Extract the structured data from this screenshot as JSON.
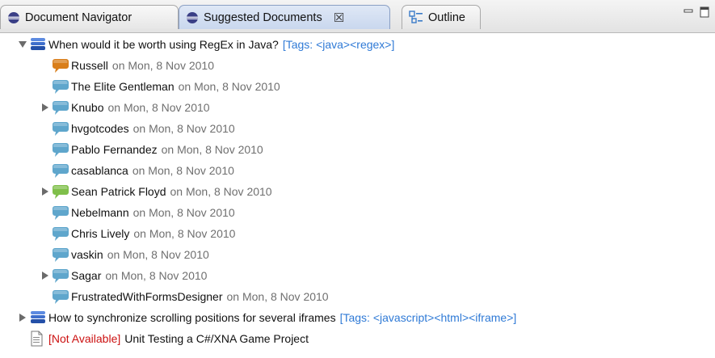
{
  "tabs": [
    {
      "label": "Document Navigator",
      "icon": "eclipse-icon",
      "active": false
    },
    {
      "label": "Suggested Documents",
      "icon": "eclipse-icon",
      "active": true,
      "close_glyph": "☒"
    },
    {
      "label": "Outline",
      "icon": "outline-icon",
      "active": false
    }
  ],
  "tree": {
    "documents": [
      {
        "title": "When would it be worth using RegEx in Java?",
        "tags": "[Tags: <java><regex>]",
        "expanded": true,
        "answers": [
          {
            "author": "Russell",
            "date": "on Mon, 8 Nov 2010",
            "icon_color": "#d97e1a",
            "has_children": false
          },
          {
            "author": "The Elite Gentleman",
            "date": "on Mon, 8 Nov 2010",
            "icon_color": "#5fa6cc",
            "has_children": false
          },
          {
            "author": "Knubo",
            "date": "on Mon, 8 Nov 2010",
            "icon_color": "#5fa6cc",
            "has_children": true
          },
          {
            "author": "hvgotcodes",
            "date": "on Mon, 8 Nov 2010",
            "icon_color": "#5fa6cc",
            "has_children": false
          },
          {
            "author": "Pablo Fernandez",
            "date": "on Mon, 8 Nov 2010",
            "icon_color": "#5fa6cc",
            "has_children": false
          },
          {
            "author": "casablanca",
            "date": "on Mon, 8 Nov 2010",
            "icon_color": "#5fa6cc",
            "has_children": false
          },
          {
            "author": "Sean Patrick Floyd",
            "date": "on Mon, 8 Nov 2010",
            "icon_color": "#7fbf4a",
            "has_children": true
          },
          {
            "author": "Nebelmann",
            "date": "on Mon, 8 Nov 2010",
            "icon_color": "#5fa6cc",
            "has_children": false
          },
          {
            "author": "Chris Lively",
            "date": "on Mon, 8 Nov 2010",
            "icon_color": "#5fa6cc",
            "has_children": false
          },
          {
            "author": "vaskin",
            "date": "on Mon, 8 Nov 2010",
            "icon_color": "#5fa6cc",
            "has_children": false
          },
          {
            "author": "Sagar",
            "date": "on Mon, 8 Nov 2010",
            "icon_color": "#5fa6cc",
            "has_children": true
          },
          {
            "author": "FrustratedWithFormsDesigner",
            "date": "on Mon, 8 Nov 2010",
            "icon_color": "#5fa6cc",
            "has_children": false
          }
        ]
      },
      {
        "title": "How to synchronize scrolling positions for several iframes",
        "tags": "[Tags: <javascript><html><iframe>]",
        "expanded": false,
        "answers": []
      }
    ],
    "unavailable": {
      "status": "[Not Available]",
      "title": "Unit Testing a C#/XNA Game Project"
    }
  },
  "colors": {
    "tag_blue": "#2f7ad6",
    "date_gray": "#6f6f6f",
    "not_available_red": "#cc1111"
  }
}
